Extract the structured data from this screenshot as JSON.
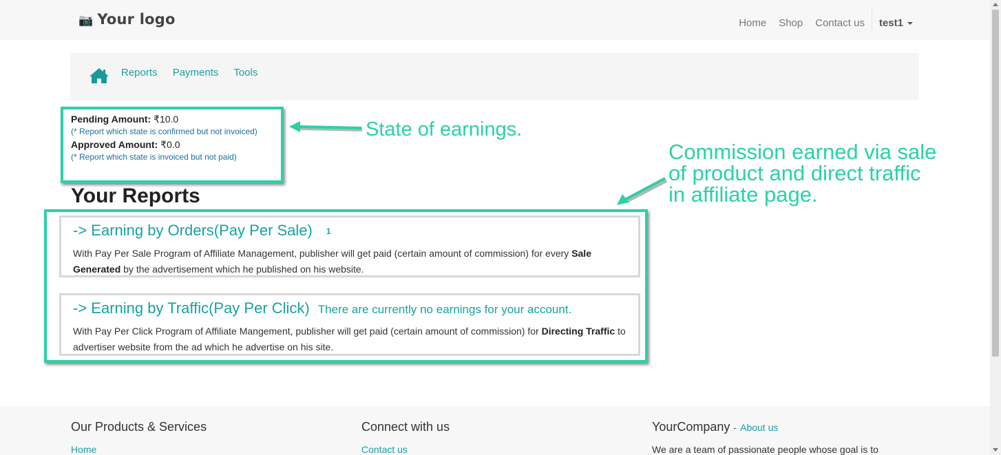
{
  "header": {
    "logo_icon": "camera-icon",
    "logo_text": "Your logo",
    "nav": [
      "Home",
      "Shop",
      "Contact us"
    ],
    "user": "test1"
  },
  "subnav": {
    "home_icon": "home-icon",
    "items": [
      "Reports",
      "Payments",
      "Tools"
    ]
  },
  "amounts": {
    "pending_label": "Pending Amount:",
    "pending_value": "₹10.0",
    "pending_note": "(* Report which state is confirmed but not invoiced)",
    "approved_label": "Approved Amount:",
    "approved_value": "₹0.0",
    "approved_note": "(* Report which state is invoiced but not paid)"
  },
  "annotations": {
    "state": "State of earnings.",
    "commission_lines": [
      "Commission earned via sale",
      "of product and direct traffic",
      "in affiliate page."
    ],
    "color": "#2bd1a7"
  },
  "reports": {
    "title": "Your Reports",
    "orders": {
      "title": "-> Earning by Orders(Pay Per Sale)",
      "badge": "1",
      "desc_pre": "With Pay Per Sale Program of Affiliate Management, publisher will get paid (certain amount of commission) for every",
      "desc_bold": "Sale Generated",
      "desc_post": "by the advertisement which he published on his website."
    },
    "traffic": {
      "title": "-> Earning by Traffic(Pay Per Click)",
      "message": "There are currently no earnings for your account.",
      "desc_pre": "With Pay Per Click Program of Affiliate Mangement, publisher will get paid (certain amount of commission) for",
      "desc_bold": "Directing Traffic",
      "desc_post": "to advertiser website from the ad which he advertise on his site."
    }
  },
  "footer": {
    "col1_title": "Our Products & Services",
    "col1_link": "Home",
    "col2_title": "Connect with us",
    "col2_link": "Contact us",
    "col3_title": "YourCompany",
    "col3_sep": "-",
    "col3_about": "About us",
    "col3_text": "We are a team of passionate people whose goal is to"
  },
  "colors": {
    "accent": "#17a2a2",
    "highlight": "#2bd1a7"
  }
}
